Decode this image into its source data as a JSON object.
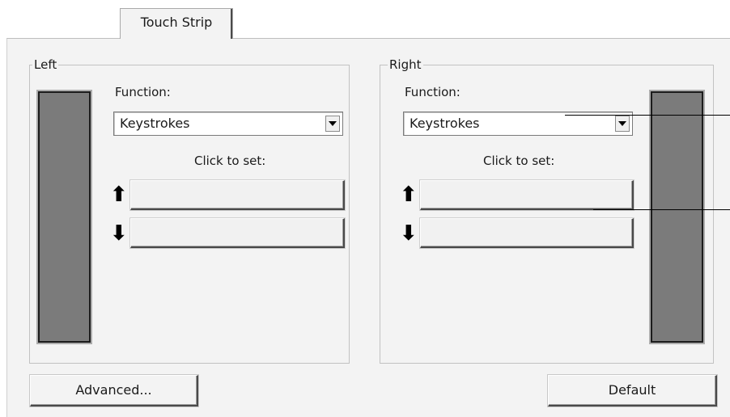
{
  "tab": {
    "label": "Touch Strip"
  },
  "left": {
    "group_label": "Left",
    "function_label": "Function:",
    "function_value": "Keystrokes",
    "click_to_set": "Click to set:",
    "up_arrow": "⬆",
    "down_arrow": "⬇",
    "up_key": "",
    "down_key": ""
  },
  "right": {
    "group_label": "Right",
    "function_label": "Function:",
    "function_value": "Keystrokes",
    "click_to_set": "Click to set:",
    "up_arrow": "⬆",
    "down_arrow": "⬇",
    "up_key": "",
    "down_key": ""
  },
  "buttons": {
    "advanced": "Advanced...",
    "default": "Default"
  },
  "colors": {
    "background": "#f3f3f3",
    "strip": "#7b7b7b"
  },
  "icons": {
    "up": "arrow-up-icon",
    "down": "arrow-down-icon",
    "dropdown": "chevron-down-icon"
  }
}
